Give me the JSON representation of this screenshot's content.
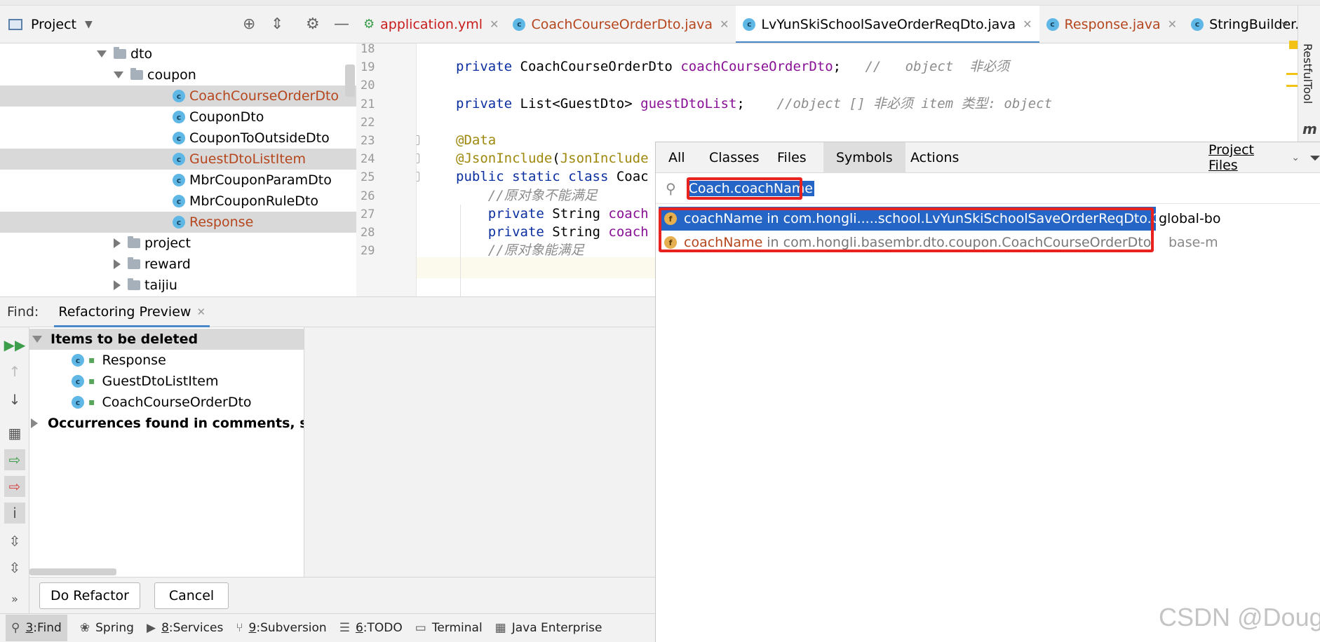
{
  "project_panel": {
    "title": "Project",
    "tree": [
      {
        "label": "dto",
        "kind": "folder",
        "expanded": true,
        "depth": 0
      },
      {
        "label": "coupon",
        "kind": "folder",
        "expanded": true,
        "depth": 1
      },
      {
        "label": "CoachCourseOrderDto",
        "kind": "class",
        "depth": 2,
        "selected": true,
        "highlight": true
      },
      {
        "label": "CouponDto",
        "kind": "class",
        "depth": 2
      },
      {
        "label": "CouponToOutsideDto",
        "kind": "class",
        "depth": 2
      },
      {
        "label": "GuestDtoListItem",
        "kind": "class",
        "depth": 2,
        "selected": true,
        "highlight": true
      },
      {
        "label": "MbrCouponParamDto",
        "kind": "class",
        "depth": 2
      },
      {
        "label": "MbrCouponRuleDto",
        "kind": "class",
        "depth": 2
      },
      {
        "label": "Response",
        "kind": "class",
        "depth": 2,
        "selected": true,
        "highlight": true
      },
      {
        "label": "project",
        "kind": "folder",
        "expanded": false,
        "depth": 1
      },
      {
        "label": "reward",
        "kind": "folder",
        "expanded": false,
        "depth": 1
      },
      {
        "label": "taijiu",
        "kind": "folder",
        "expanded": false,
        "depth": 1
      }
    ]
  },
  "editor_tabs": [
    {
      "label": "application.yml",
      "icon": "yaml-icon",
      "color": "#c91c1c"
    },
    {
      "label": "CoachCourseOrderDto.java",
      "icon": "class-icon",
      "color": "#b5461d"
    },
    {
      "label": "LvYunSkiSchoolSaveOrderReqDto.java",
      "icon": "class-icon",
      "color": "#000000",
      "active": true
    },
    {
      "label": "Response.java",
      "icon": "class-icon",
      "color": "#b5461d"
    },
    {
      "label": "StringBuilder.java",
      "icon": "class-icon",
      "color": "#000000"
    }
  ],
  "code_lines": [
    {
      "num": "18",
      "text": ""
    },
    {
      "num": "19",
      "text": "private CoachCourseOrderDto coachCourseOrderDto;   //   object  非必须"
    },
    {
      "num": "20",
      "text": ""
    },
    {
      "num": "21",
      "text": "private List<GuestDto> guestDtoList;    //object [] 非必须 item 类型: object"
    },
    {
      "num": "22",
      "text": ""
    },
    {
      "num": "23",
      "text": "@Data"
    },
    {
      "num": "24",
      "text": "@JsonInclude(JsonInclude"
    },
    {
      "num": "25",
      "text": "public static class Coac"
    },
    {
      "num": "26",
      "text": "    //原对象不能满足"
    },
    {
      "num": "27",
      "text": "    private String coach"
    },
    {
      "num": "28",
      "text": "    private String coach"
    },
    {
      "num": "29",
      "text": "    //原对象能满足"
    }
  ],
  "find_panel": {
    "find_label": "Find:",
    "tab_label": "Refactoring Preview",
    "group1": "Items to be deleted",
    "items": [
      "Response",
      "GuestDtoListItem",
      "CoachCourseOrderDto"
    ],
    "group2": "Occurrences found in comments, string",
    "do_refactor": "Do Refactor",
    "cancel": "Cancel"
  },
  "status_bar": [
    {
      "num": "3",
      "label": "Find",
      "icon": "search-icon"
    },
    {
      "num": "",
      "label": "Spring",
      "icon": "spring-icon"
    },
    {
      "num": "8",
      "label": "Services",
      "icon": "services-icon"
    },
    {
      "num": "9",
      "label": "Subversion",
      "icon": "subversion-icon"
    },
    {
      "num": "6",
      "label": "TODO",
      "icon": "todo-icon"
    },
    {
      "num": "",
      "label": "Terminal",
      "icon": "terminal-icon"
    },
    {
      "num": "",
      "label": "Java Enterprise",
      "icon": "java-enterprise-icon"
    }
  ],
  "search_popup": {
    "tabs": [
      "All",
      "Classes",
      "Files",
      "Symbols",
      "Actions"
    ],
    "active_tab": "Symbols",
    "scope": "Project Files",
    "query": "Coach.coachName",
    "results": [
      {
        "name": "coachName",
        "location": "in com.hongli.....school.LvYunSkiSchoolSaveOrderReqDto.CoachCourseOrderDto",
        "module": "global-bo",
        "selected": true
      },
      {
        "name": "coachName",
        "location": "in com.hongli.basembr.dto.coupon.CoachCourseOrderDto",
        "module": "base-m",
        "selected": false
      }
    ]
  },
  "right_sidebar": {
    "label": "RestfulTool"
  },
  "watermark": "CSDN @Doug."
}
